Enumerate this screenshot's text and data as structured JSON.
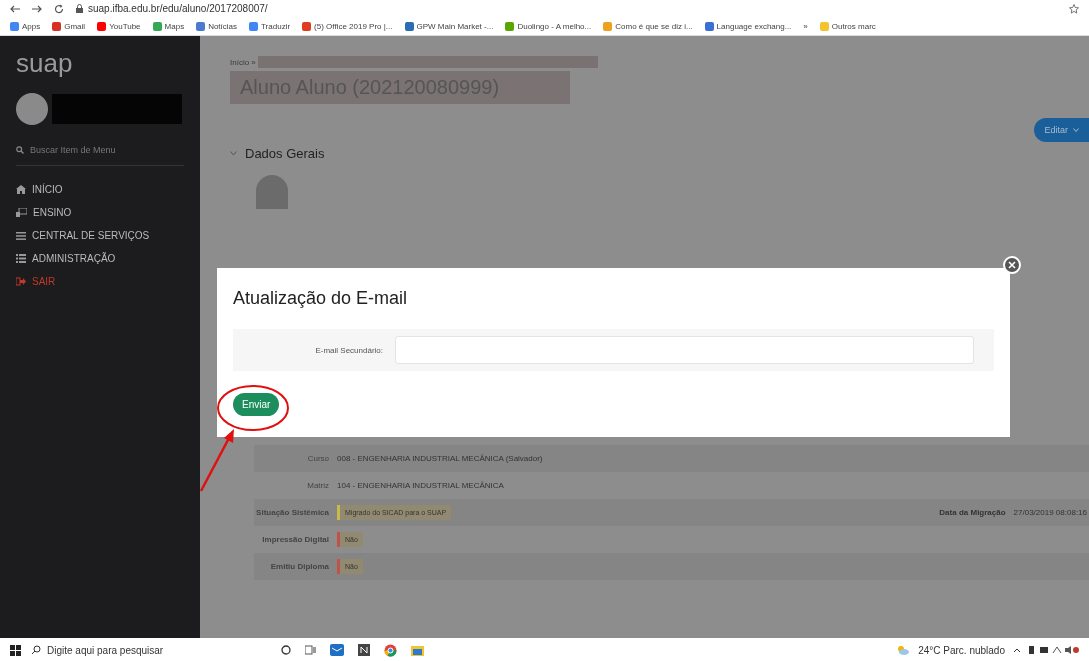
{
  "browser": {
    "url": "suap.ifba.edu.br/edu/aluno/2017208007/",
    "bookmarks": [
      {
        "label": "Apps",
        "color": "#4285f4"
      },
      {
        "label": "Gmail",
        "color": "#d93025"
      },
      {
        "label": "YouTube",
        "color": "#ff0000"
      },
      {
        "label": "Maps",
        "color": "#34a853"
      },
      {
        "label": "Notícias",
        "color": "#4a7bd0"
      },
      {
        "label": "Traduzir",
        "color": "#4285f4"
      },
      {
        "label": "(5) Office 2019 Pro |...",
        "color": "#e03c1f"
      },
      {
        "label": "GPW Main Market -...",
        "color": "#2a6db5"
      },
      {
        "label": "Duolingo - A melho...",
        "color": "#58a700"
      },
      {
        "label": "Como é que se diz i...",
        "color": "#f0a020"
      },
      {
        "label": "Language exchang...",
        "color": "#3b6fd6"
      },
      {
        "label": "»"
      },
      {
        "label": "Outros marc",
        "color": "#f4c430"
      }
    ]
  },
  "sidebar": {
    "logo": "suap",
    "search_placeholder": "Buscar Item de Menu",
    "items": [
      {
        "label": "INÍCIO",
        "kind": "home"
      },
      {
        "label": "ENSINO",
        "kind": "teaching"
      },
      {
        "label": "CENTRAL DE SERVIÇOS",
        "kind": "list"
      },
      {
        "label": "ADMINISTRAÇÃO",
        "kind": "admin"
      },
      {
        "label": "SAIR",
        "kind": "logout"
      }
    ]
  },
  "page": {
    "breadcrumb": "Início »",
    "title": "Aluno Aluno (202120080999)",
    "edit_button": "Editar",
    "section": "Dados Gerais",
    "rows": [
      {
        "label": "Curso",
        "value": "008 - ENGENHARIA INDUSTRIAL MECÂNICA (Salvador)",
        "kind": "text"
      },
      {
        "label": "Matriz",
        "value": "104 - ENGENHARIA INDUSTRIAL MECÂNICA",
        "kind": "text"
      },
      {
        "label": "Situação Sistêmica",
        "value": "Migrado do SICAD para o SUAP",
        "kind": "badge",
        "color": "#c9b84a",
        "extra_label": "Data da Migração",
        "extra_value": "27/03/2019 08:08:16"
      },
      {
        "label": "Impressão Digital",
        "value": "Não",
        "kind": "badge",
        "color": "#c0524a"
      },
      {
        "label": "Emitiu Diploma",
        "value": "Não",
        "kind": "badge",
        "color": "#c0524a"
      }
    ]
  },
  "modal": {
    "title": "Atualização do E-mail",
    "field_label": "E-mail Secundário:",
    "submit": "Enviar"
  },
  "taskbar": {
    "search_placeholder": "Digite aqui para pesquisar",
    "weather": "24°C  Parc. nublado"
  }
}
